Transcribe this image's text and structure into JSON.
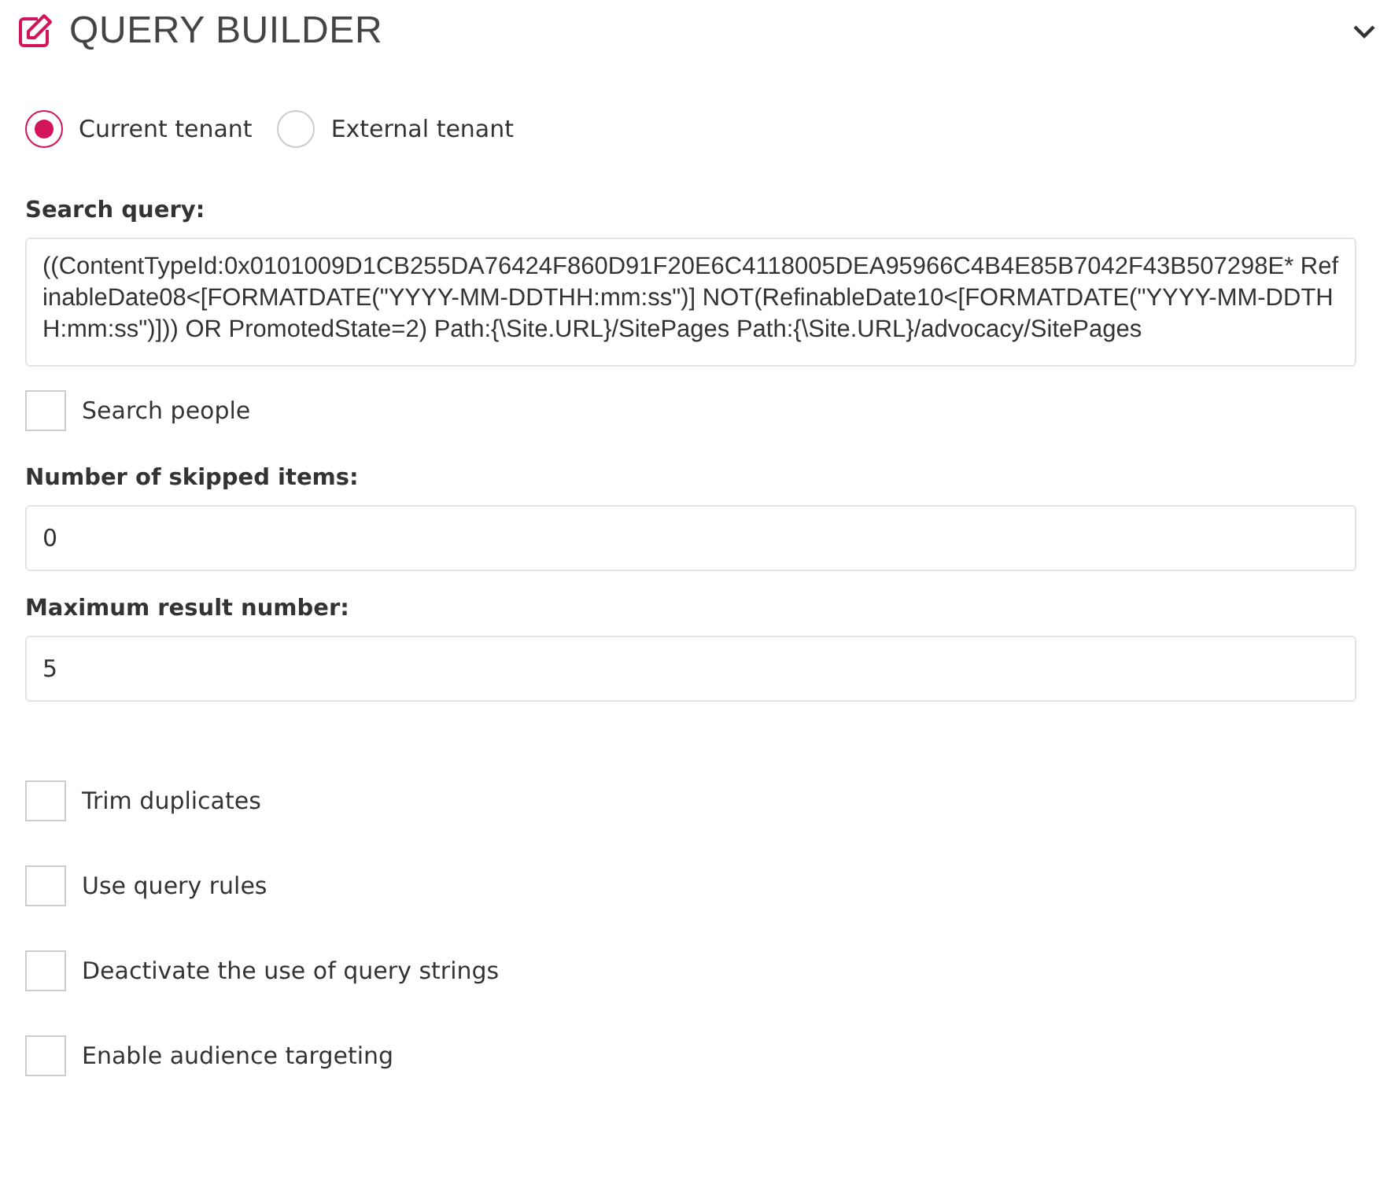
{
  "header": {
    "title": "QUERY BUILDER"
  },
  "tenant": [
    {
      "label": "Current tenant",
      "selected": true
    },
    {
      "label": "External tenant",
      "selected": false
    }
  ],
  "search_query": {
    "label": "Search query:",
    "value": "((ContentTypeId:0x0101009D1CB255DA76424F860D91F20E6C4118005DEA95966C4B4E85B7042F43B507298E* RefinableDate08<[FORMATDATE(\"YYYY-MM-DDTHH:mm:ss\")] NOT(RefinableDate10<[FORMATDATE(\"YYYY-MM-DDTHH:mm:ss\")])) OR PromotedState=2) Path:{\\Site.URL}/SitePages Path:{\\Site.URL}/advocacy/SitePages"
  },
  "search_people": {
    "label": "Search people",
    "checked": false
  },
  "fields": [
    {
      "label": "Number of skipped items:",
      "value": "0"
    },
    {
      "label": "Maximum result number:",
      "value": "5"
    }
  ],
  "options": [
    {
      "label": "Trim duplicates",
      "checked": false
    },
    {
      "label": "Use query rules",
      "checked": false
    },
    {
      "label": "Deactivate the use of query strings",
      "checked": false
    },
    {
      "label": "Enable audience targeting",
      "checked": false
    }
  ]
}
